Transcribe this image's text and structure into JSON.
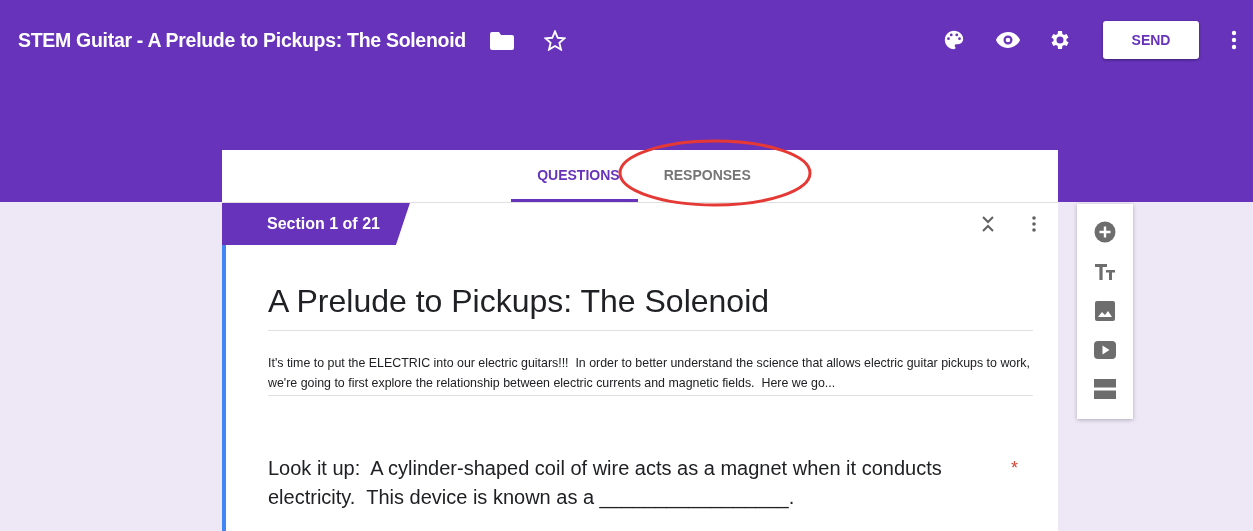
{
  "header": {
    "title": "STEM Guitar - A Prelude to Pickups: The Solenoid",
    "send_button": "SEND"
  },
  "tabs": [
    {
      "label": "QUESTIONS",
      "selected": true
    },
    {
      "label": "RESPONSES",
      "selected": false
    }
  ],
  "section": {
    "badge": "Section 1 of 21",
    "title": "A Prelude to Pickups: The Solenoid",
    "description": "It's time to put the ELECTRIC into our electric guitars!!!  In order to better understand the science that allows electric guitar pickups to work, we're going to first explore the relationship between electric currents and magnetic fields.  Here we go..."
  },
  "questions": [
    {
      "text": "Look it up:  A cylinder-shaped coil of wire acts as a magnet when it conducts electricity.  This device is known as a _________________.",
      "required": true,
      "required_mark": "*"
    }
  ]
}
